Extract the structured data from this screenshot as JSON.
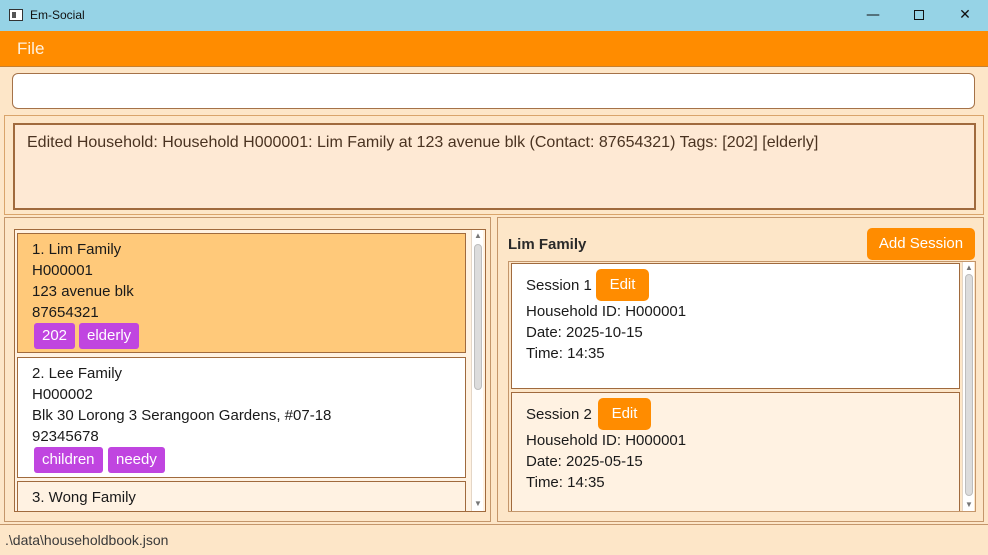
{
  "window": {
    "title": "Em-Social",
    "controls": {
      "minimize": "—",
      "close": "✕"
    }
  },
  "menu": {
    "file": "File"
  },
  "command": {
    "value": "",
    "placeholder": ""
  },
  "result": {
    "text": "Edited Household: Household H000001: Lim Family at 123 avenue blk (Contact: 87654321) Tags: [202] [elderly]"
  },
  "households": [
    {
      "header": "1.  Lim Family",
      "id": "H000001",
      "address": "123 avenue blk",
      "contact": "87654321",
      "tags": [
        "202",
        "elderly"
      ]
    },
    {
      "header": "2.  Lee Family",
      "id": "H000002",
      "address": "Blk 30 Lorong 3 Serangoon Gardens, #07-18",
      "contact": "92345678",
      "tags": [
        "children",
        "needy"
      ]
    },
    {
      "header": "3.  Wong Family"
    }
  ],
  "detail": {
    "title": "Lim Family",
    "add_session": "Add Session",
    "sessions": [
      {
        "title": "Session 1",
        "edit": "Edit",
        "household_id": "Household ID: H000001",
        "date": "Date: 2025-10-15",
        "time": "Time: 14:35"
      },
      {
        "title": "Session 2",
        "edit": "Edit",
        "household_id": "Household ID: H000001",
        "date": "Date: 2025-05-15",
        "time": "Time: 14:35"
      }
    ]
  },
  "status": {
    "path": ".\\data\\householdbook.json"
  },
  "colors": {
    "titlebar": "#96d3e6",
    "menubar": "#ff8c00",
    "background": "#fde6c8",
    "selected_card": "#ffc97a",
    "tag": "#c045e0",
    "button": "#ff8c00"
  }
}
